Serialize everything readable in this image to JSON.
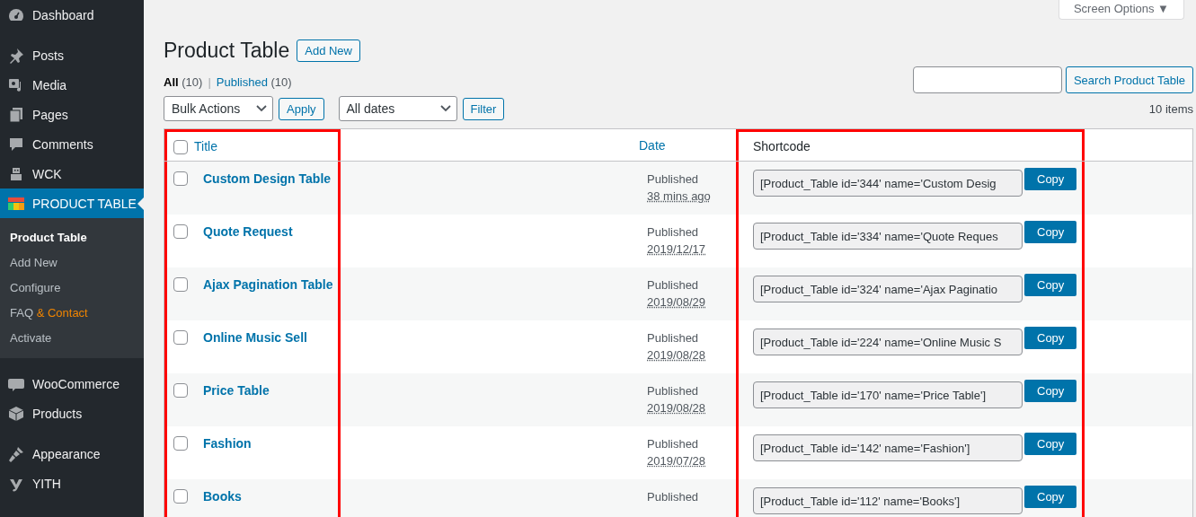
{
  "sidebar": {
    "groups": [
      {
        "items": [
          {
            "label": "Dashboard",
            "selected": false
          }
        ]
      },
      {
        "items": [
          {
            "label": "Posts",
            "selected": false
          },
          {
            "label": "Media",
            "selected": false
          },
          {
            "label": "Pages",
            "selected": false
          },
          {
            "label": "Comments",
            "selected": false
          },
          {
            "label": "WCK",
            "selected": false
          },
          {
            "label": "PRODUCT TABLE",
            "selected": true,
            "children": [
              {
                "parts": [
                  {
                    "text": "Product Table",
                    "highlight": false
                  }
                ],
                "selected": true
              },
              {
                "parts": [
                  {
                    "text": "Add New",
                    "highlight": false
                  }
                ],
                "selected": false
              },
              {
                "parts": [
                  {
                    "text": "Configure",
                    "highlight": false
                  }
                ],
                "selected": false
              },
              {
                "parts": [
                  {
                    "text": "FAQ",
                    "highlight": false
                  },
                  {
                    "text": "& Contact",
                    "highlight": true
                  }
                ],
                "selected": false
              },
              {
                "parts": [
                  {
                    "text": "Activate",
                    "highlight": false
                  }
                ],
                "selected": false
              }
            ]
          }
        ]
      },
      {
        "items": [
          {
            "label": "WooCommerce",
            "selected": false
          },
          {
            "label": "Products",
            "selected": false
          }
        ]
      },
      {
        "items": [
          {
            "label": "Appearance",
            "selected": false
          },
          {
            "label": "YITH",
            "selected": false
          }
        ]
      }
    ]
  },
  "screen_options": "Screen Options ▼",
  "heading": "Product Table",
  "add_new": "Add New",
  "views": [
    {
      "label": "All",
      "count": "(10)",
      "selected": true
    },
    {
      "label": "Published",
      "count": "(10)",
      "selected": false
    }
  ],
  "views_separator": "|",
  "search": {
    "button": "Search Product Table"
  },
  "bulk_actions": {
    "value": "Bulk Actions",
    "button": "Apply"
  },
  "date_filter": {
    "value": "All dates",
    "button": "Filter"
  },
  "items_count": "10 items",
  "table": {
    "select_all_checked": false,
    "columns": [
      {
        "label": "Title",
        "sortable": true,
        "highlighted": true
      },
      {
        "label": "Date",
        "sortable": true,
        "highlighted": false
      },
      {
        "label": "Shortcode",
        "sortable": false,
        "highlighted": true
      }
    ],
    "rows": [
      {
        "checked": false,
        "title": "Custom Design Table",
        "status": "Published",
        "date": "38 mins ago",
        "shortcode": "[Product_Table id='344' name='Custom Desig",
        "copy": "Copy"
      },
      {
        "checked": false,
        "title": "Quote Request",
        "status": "Published",
        "date": "2019/12/17",
        "shortcode": "[Product_Table id='334' name='Quote Reques",
        "copy": "Copy"
      },
      {
        "checked": false,
        "title": "Ajax Pagination Table",
        "status": "Published",
        "date": "2019/08/29",
        "shortcode": "[Product_Table id='324' name='Ajax Paginatio",
        "copy": "Copy"
      },
      {
        "checked": false,
        "title": "Online Music Sell",
        "status": "Published",
        "date": "2019/08/28",
        "shortcode": "[Product_Table id='224' name='Online Music S",
        "copy": "Copy"
      },
      {
        "checked": false,
        "title": "Price Table",
        "status": "Published",
        "date": "2019/08/28",
        "shortcode": "[Product_Table id='170' name='Price Table']",
        "copy": "Copy"
      },
      {
        "checked": false,
        "title": "Fashion",
        "status": "Published",
        "date": "2019/07/28",
        "shortcode": "[Product_Table id='142' name='Fashion']",
        "copy": "Copy"
      },
      {
        "checked": false,
        "title": "Books",
        "status": "Published",
        "shortcode": "[Product_Table id='112' name='Books']",
        "copy": "Copy"
      }
    ]
  }
}
